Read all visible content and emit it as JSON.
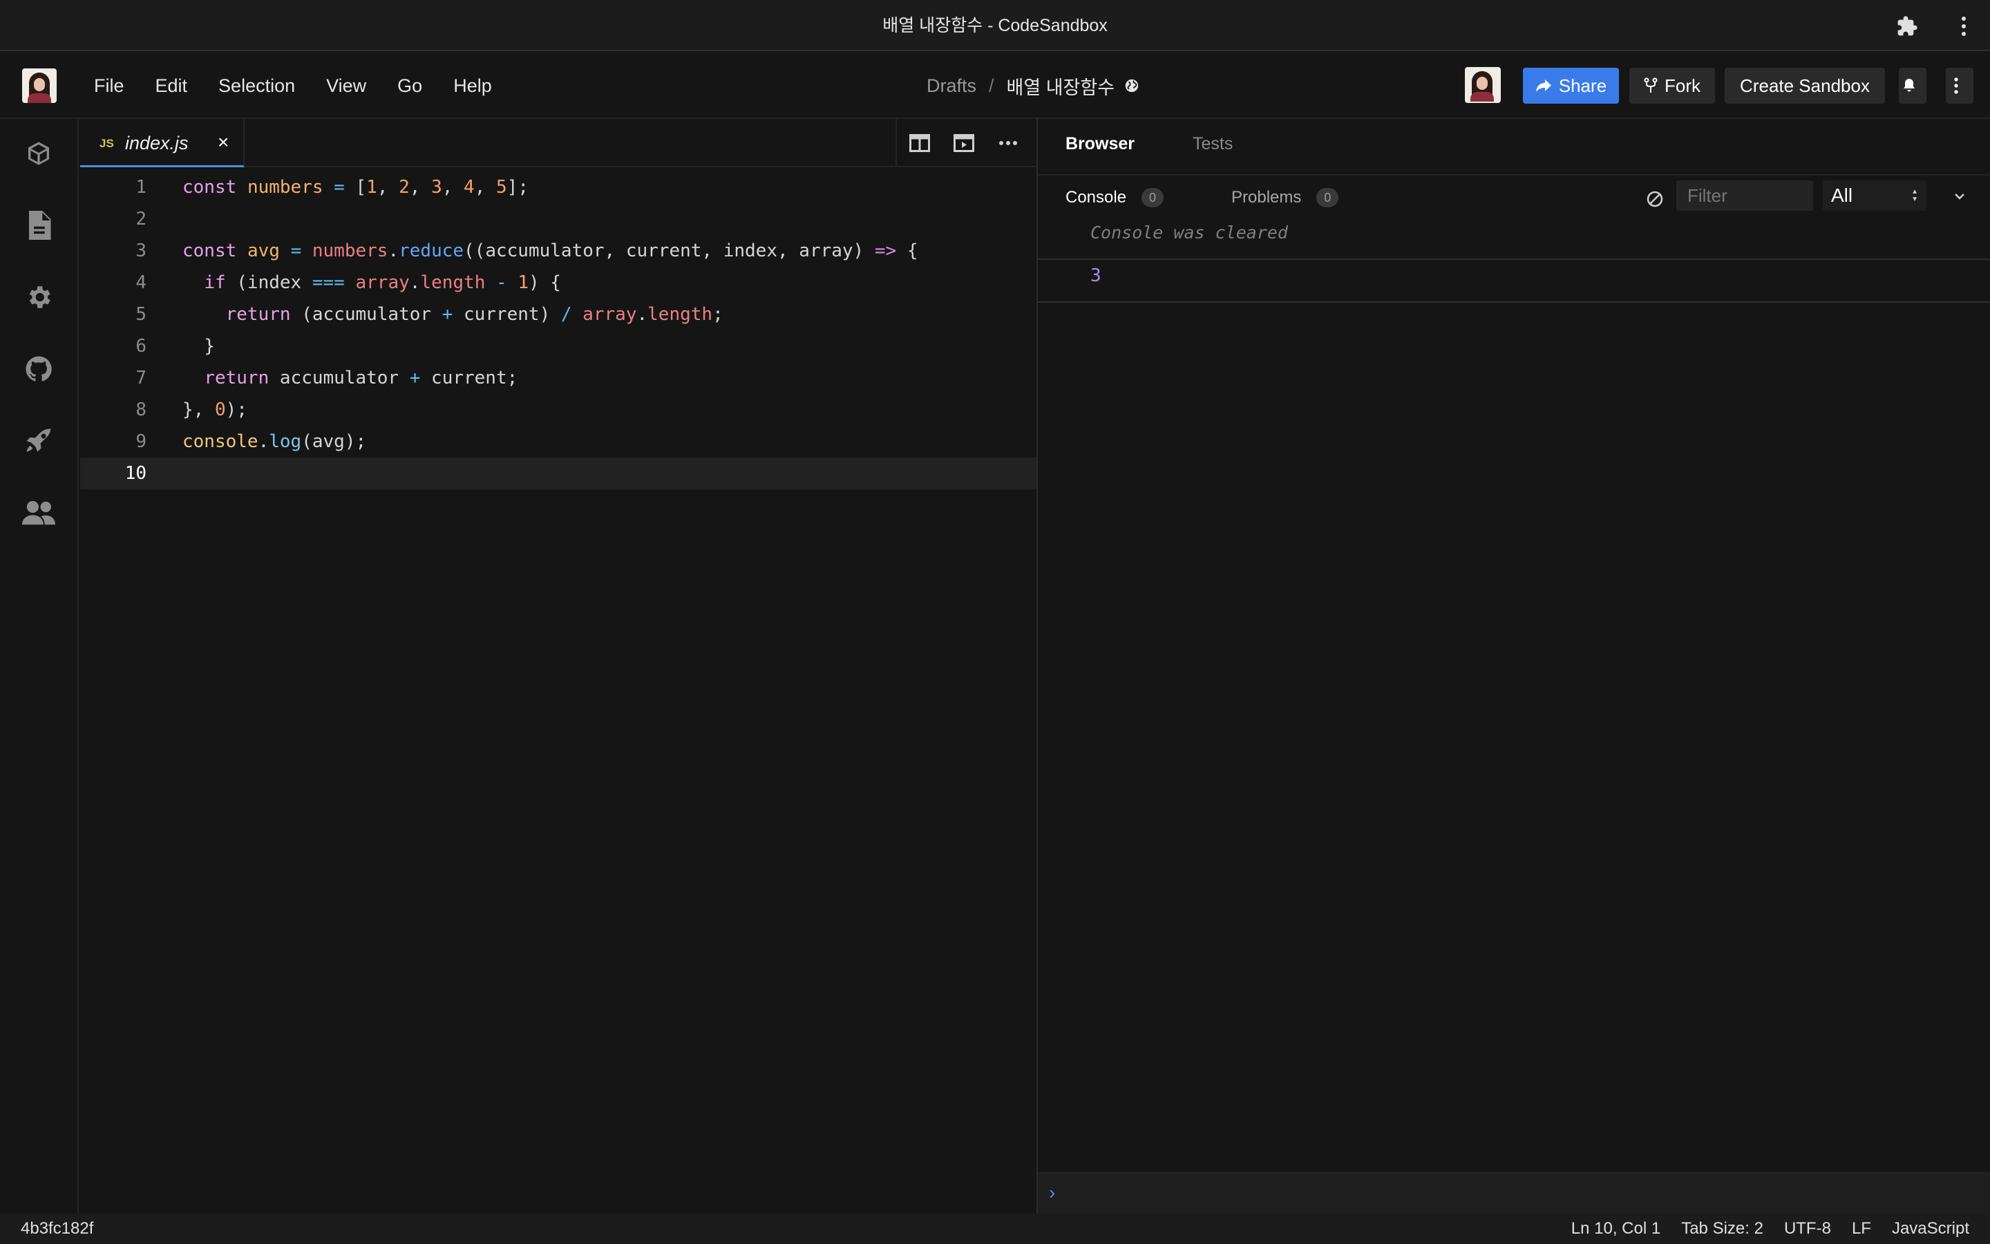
{
  "window": {
    "title": "배열 내장함수 - CodeSandbox"
  },
  "menu": {
    "items": [
      "File",
      "Edit",
      "Selection",
      "View",
      "Go",
      "Help"
    ]
  },
  "breadcrumb": {
    "folder": "Drafts",
    "separator": "/",
    "sandbox": "배열 내장함수"
  },
  "header_actions": {
    "share": "Share",
    "fork": "Fork",
    "create": "Create Sandbox"
  },
  "editor": {
    "tab": {
      "badge": "JS",
      "filename": "index.js",
      "close": "×"
    },
    "line_numbers": [
      "1",
      "2",
      "3",
      "4",
      "5",
      "6",
      "7",
      "8",
      "9",
      "10"
    ],
    "active_line": 10
  },
  "panel": {
    "tabs": [
      "Browser",
      "Tests"
    ],
    "console_tabs": [
      {
        "label": "Console",
        "count": "0"
      },
      {
        "label": "Problems",
        "count": "0"
      }
    ],
    "filter_placeholder": "Filter",
    "level": "All",
    "cleared_message": "Console was cleared",
    "output_value": "3",
    "prompt": "›"
  },
  "status": {
    "commit": "4b3fc182f",
    "position": "Ln 10, Col 1",
    "tab_size": "Tab Size: 2",
    "encoding": "UTF-8",
    "eol": "LF",
    "language": "JavaScript"
  },
  "colors": {
    "accent": "#3a7bea",
    "background": "#151515"
  },
  "icons": [
    "puzzle-icon",
    "kebab-icon",
    "globe-icon",
    "share-arrow-icon",
    "fork-icon",
    "bell-icon",
    "cube-icon",
    "file-icon",
    "gear-icon",
    "github-icon",
    "rocket-icon",
    "team-icon",
    "split-view-icon",
    "preview-icon",
    "ellipsis-icon",
    "clear-console-icon",
    "chevron-down-icon"
  ]
}
